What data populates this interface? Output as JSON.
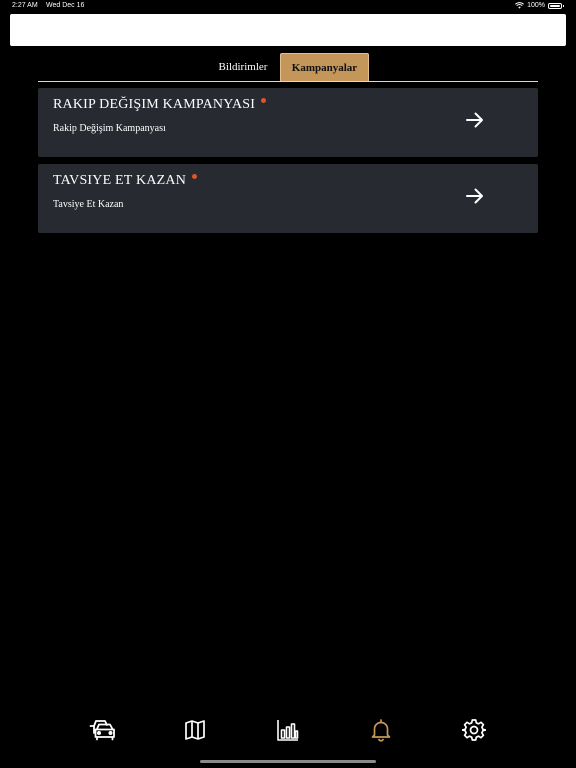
{
  "status_bar": {
    "time": "2:27 AM",
    "date": "Wed Dec 16",
    "battery": "100%"
  },
  "tabs": [
    {
      "label": "Bildirimler",
      "active": false
    },
    {
      "label": "Kampanyalar",
      "active": true
    }
  ],
  "campaigns": [
    {
      "title": "RAKIP DEĞIŞIM KAMPANYASI",
      "subtitle": "Rakip Değişim Kampanyası",
      "unread": true
    },
    {
      "title": "TAVSIYE ET KAZAN",
      "subtitle": "Tavsiye Et Kazan",
      "unread": true
    }
  ],
  "bottom_nav": [
    {
      "icon": "car-icon",
      "active": false
    },
    {
      "icon": "map-icon",
      "active": false
    },
    {
      "icon": "bar-chart-icon",
      "active": false
    },
    {
      "icon": "bell-icon",
      "active": true
    },
    {
      "icon": "gear-icon",
      "active": false
    }
  ],
  "colors": {
    "background": "#000000",
    "card": "#272a31",
    "accent": "#c4965a",
    "unread_dot": "#e0552b",
    "inactive_icon": "#ffffff",
    "active_icon": "#c4965a"
  }
}
